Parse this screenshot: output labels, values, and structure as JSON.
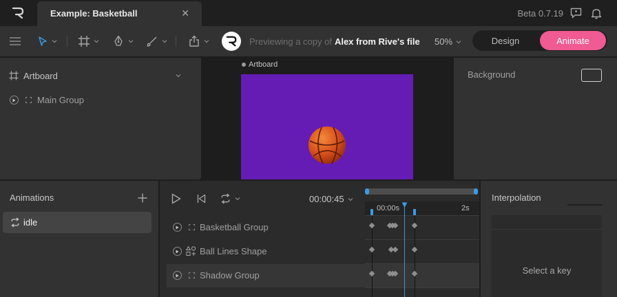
{
  "window": {
    "tab_title": "Example: Basketball",
    "tab_close": "✕",
    "version": "Beta 0.7.19"
  },
  "toolbar": {
    "preview_prefix": "Previewing a copy of",
    "preview_name": "Alex from Rive's file",
    "zoom": "50%",
    "design_label": "Design",
    "animate_label": "Animate"
  },
  "hierarchy": {
    "artboard_label": "Artboard",
    "main_group_label": "Main Group"
  },
  "stage": {
    "artboard_label": "Artboard"
  },
  "inspector": {
    "background_label": "Background"
  },
  "animations": {
    "title": "Animations",
    "items": [
      {
        "label": "idle"
      }
    ]
  },
  "timeline": {
    "time": "00:00:45",
    "ruler_start": "00:00s",
    "ruler_end": "2s",
    "tracks": [
      {
        "label": "Basketball Group"
      },
      {
        "label": "Ball Lines Shape"
      },
      {
        "label": "Shadow Group"
      }
    ]
  },
  "interpolation": {
    "title": "Interpolation",
    "empty_label": "Select a key"
  },
  "colors": {
    "accent_pink": "#ef5b92",
    "accent_blue": "#3b9be6",
    "artboard_purple": "#651cb5",
    "ball_orange": "#d9501c"
  }
}
